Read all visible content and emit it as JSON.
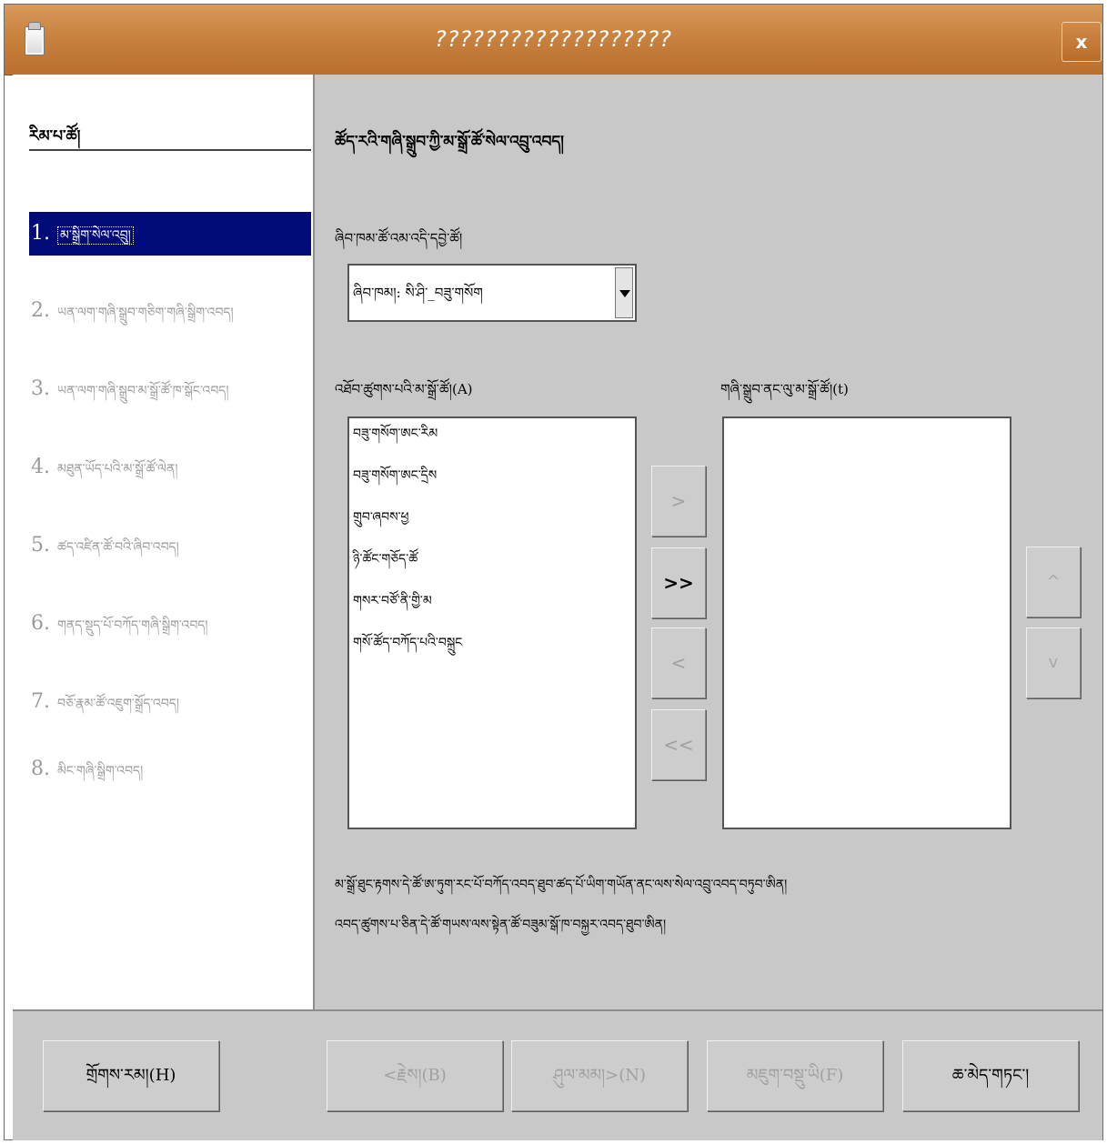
{
  "window": {
    "title": "???????????????????",
    "close_label": "x"
  },
  "steps": {
    "heading": "རིམ་པ་ཚོ།",
    "items": [
      {
        "num": "1.",
        "label": "མ་སྒྲིག་སེལ་འབྲུ།",
        "active": true
      },
      {
        "num": "2.",
        "label": "ཡན་ལག་གཞི་སྒྲུབ་གཅིག་གཞི་སྒྲིག་འབད།",
        "active": false
      },
      {
        "num": "3.",
        "label": "ཡན་ལག་གཞི་སྒྲུབ་མ་སྒྲོ་ཚོ་ཁ་སྒོང་འབད།",
        "active": false
      },
      {
        "num": "4.",
        "label": "མཐུན་ཡོད་པའི་མ་སྒྲོ་ཚོ་ལེན།",
        "active": false
      },
      {
        "num": "5.",
        "label": "ཚད་འཛིན་ཚོ་བའི་ཞིབ་འབད།",
        "active": false
      },
      {
        "num": "6.",
        "label": "གནད་སྡུད་པོ་བཀོད་གཞི་སྒྲིག་འབད།",
        "active": false
      },
      {
        "num": "7.",
        "label": "བཅོ་རྣམ་ཚོ་འཇུག་སྒྲོད་འབད།",
        "active": false
      },
      {
        "num": "8.",
        "label": "མིང་གཞི་སྒྲིག་འབད།",
        "active": false
      }
    ]
  },
  "page": {
    "title": "ཚོད་རའི་གཞི་སྒྲུབ་ཀྱི་མ་སྒྲོ་ཚོ་སེལ་འབྲུ་འབད།",
    "category_label": "ཞིབ་ཁམ་ཚོ་འམ་འདི་དབྱེ་ཚོ།",
    "category_value": "ཞིབ་ཁམ།: སི་ཤི་_བཟུ་གསོག",
    "available_label": "འཐོབ་ཚུགས་པའི་མ་སྒྲོ་ཚོ།(A)",
    "selected_label": "གཞི་སྒྲུབ་ནང་ལུ་མ་སྒྲོ་ཚོ།(t)",
    "available_items": [
      "བཟུ་གསོག་ཨང་རིམ",
      "བཟུ་གསོག་ཨང་དྲིས",
      "གྲུབ་ཞབས་ཕྱ",
      "ཉི་ཚོང་གཅོད་ཚོ",
      "གསར་བཙོ་ནི་གྱི་མ",
      "གསོ་ཚོད་བཀོད་པའི་བསྐྲུང"
    ],
    "selected_items": [],
    "description_line1": "མ་སྒྲོ་ཐུང་རྟགས་དེ་ཚོ་ཨ་ཏུག་རང་པོ་བཀོད་འབད་ཐུབ་ཚད་པོ་ཡིག་གཡོན་ནང་ལས་སེལ་འབྲུ་འབད་བཏུབ་ཨིན།",
    "description_line2": "འབད་ཚུགས་པ་ཅིན་དེ་ཚོ་གཡས་ལས་སྟེན་ཚོ་བཟུམ་སྒོ་ཁ་བསྐྱར་འབད་ཐུབ་ཨིན།"
  },
  "move_buttons": {
    "add_one": ">",
    "add_all": ">>",
    "remove_one": "<",
    "remove_all": "<<",
    "up": "^",
    "down": "v"
  },
  "footer": {
    "help": "གྲོགས་རམ།(H)",
    "back": "<རྗེས།(B)",
    "next": "ཤུལ་མམ།>(N)",
    "finish": "མཇུག་བསྡུ་ཡི(F)",
    "cancel": "ཆ་མེད་གཏང་།"
  }
}
